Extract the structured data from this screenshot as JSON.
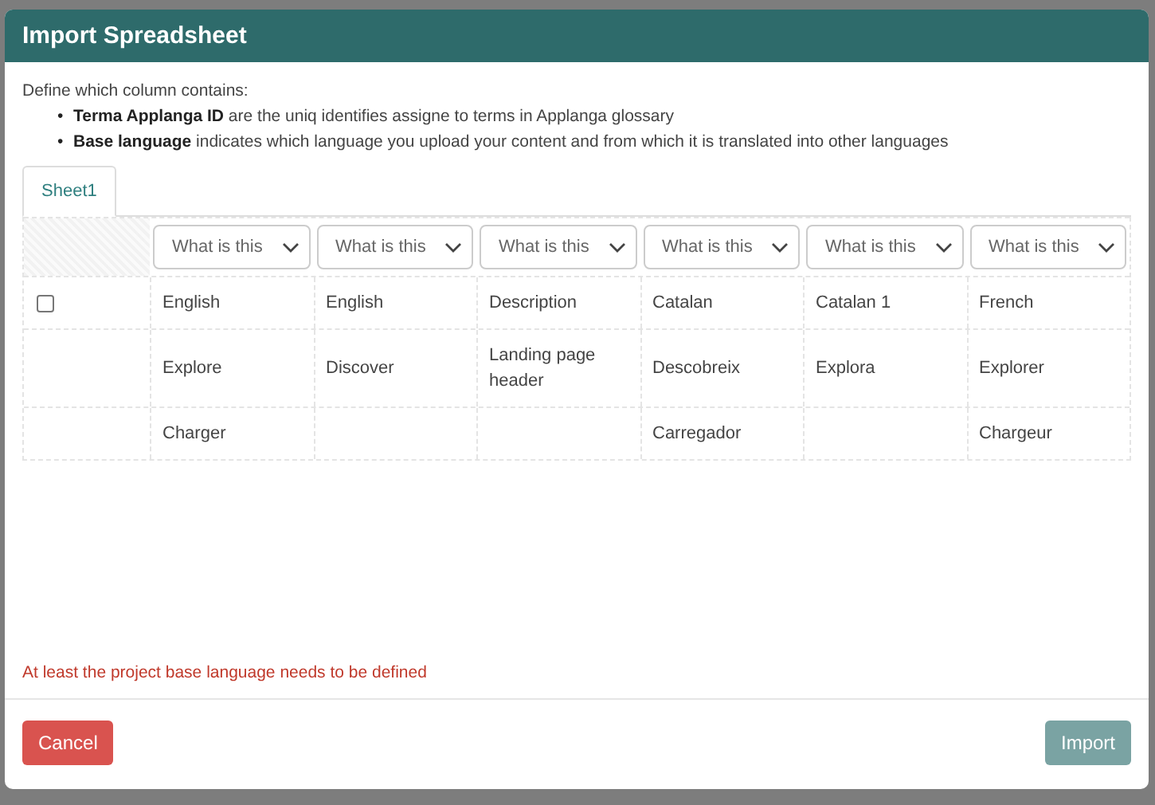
{
  "dialog": {
    "title": "Import Spreadsheet",
    "intro": "Define which column contains:",
    "bullets": [
      {
        "marker": "•",
        "text": "**Terma Applanga ID** are the uniq identifies assigne to terms in Applanga glossary"
      },
      {
        "marker": "•",
        "text": "**Base language** indicates which language you upload your content and from which it is translated into other languages"
      }
    ],
    "tabs": [
      {
        "label": "Sheet1",
        "selected": true
      }
    ],
    "table": {
      "column_selects": [
        {
          "value": "What is this"
        },
        {
          "value": "What is this"
        },
        {
          "value": "What is this"
        },
        {
          "value": "What is this"
        },
        {
          "value": "What is this"
        },
        {
          "value": "What is this"
        }
      ],
      "first_row_checkbox": {
        "checked": false
      },
      "rows": [
        {
          "cells": [
            "English",
            "English",
            "Description",
            "Catalan",
            "Catalan 1",
            "French"
          ]
        },
        {
          "cells": [
            "Explore",
            "Discover",
            "Landing page header",
            "Descobreix",
            "Explora",
            "Explorer"
          ]
        },
        {
          "cells": [
            "Charger",
            "",
            "",
            "Carregador",
            "",
            "Chargeur"
          ]
        }
      ]
    },
    "error": "At least the project base language needs to be defined",
    "buttons": [
      {
        "label": "Cancel",
        "kind": "danger",
        "disabled": false
      },
      {
        "label": "Import",
        "kind": "primary",
        "disabled": true
      }
    ]
  }
}
